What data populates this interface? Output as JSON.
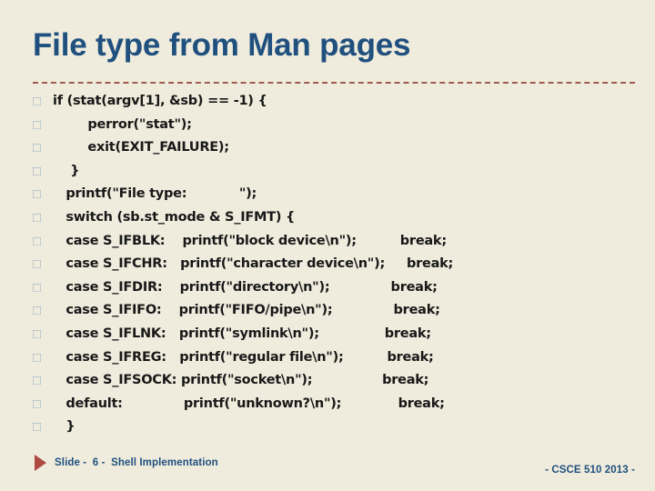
{
  "slide": {
    "title": "File type from Man pages",
    "background_color": "#EFECDD",
    "title_color": "#20507E",
    "rule_color": "#9E5B4E",
    "bullet_glyph": "□",
    "bullet_color": "#9FB3C4"
  },
  "code": {
    "lines": [
      "if (stat(argv[1], &sb) == -1) {",
      "        perror(\"stat\");",
      "        exit(EXIT_FAILURE);",
      "    }",
      "   printf(\"File type:            \");",
      "   switch (sb.st_mode & S_IFMT) {",
      "   case S_IFBLK:    printf(\"block device\\n\");          break;",
      "   case S_IFCHR:   printf(\"character device\\n\");     break;",
      "   case S_IFDIR:    printf(\"directory\\n\");              break;",
      "   case S_IFIFO:    printf(\"FIFO/pipe\\n\");              break;",
      "   case S_IFLNK:   printf(\"symlink\\n\");               break;",
      "   case S_IFREG:   printf(\"regular file\\n\");          break;",
      "   case S_IFSOCK: printf(\"socket\\n\");                break;",
      "   default:              printf(\"unknown?\\n\");             break;",
      "   }"
    ]
  },
  "footer": {
    "triangle_color": "#AE4A42",
    "left_text": "Slide -  6 -  Shell Implementation",
    "right_text": "- CSCE 510 2013 -"
  }
}
